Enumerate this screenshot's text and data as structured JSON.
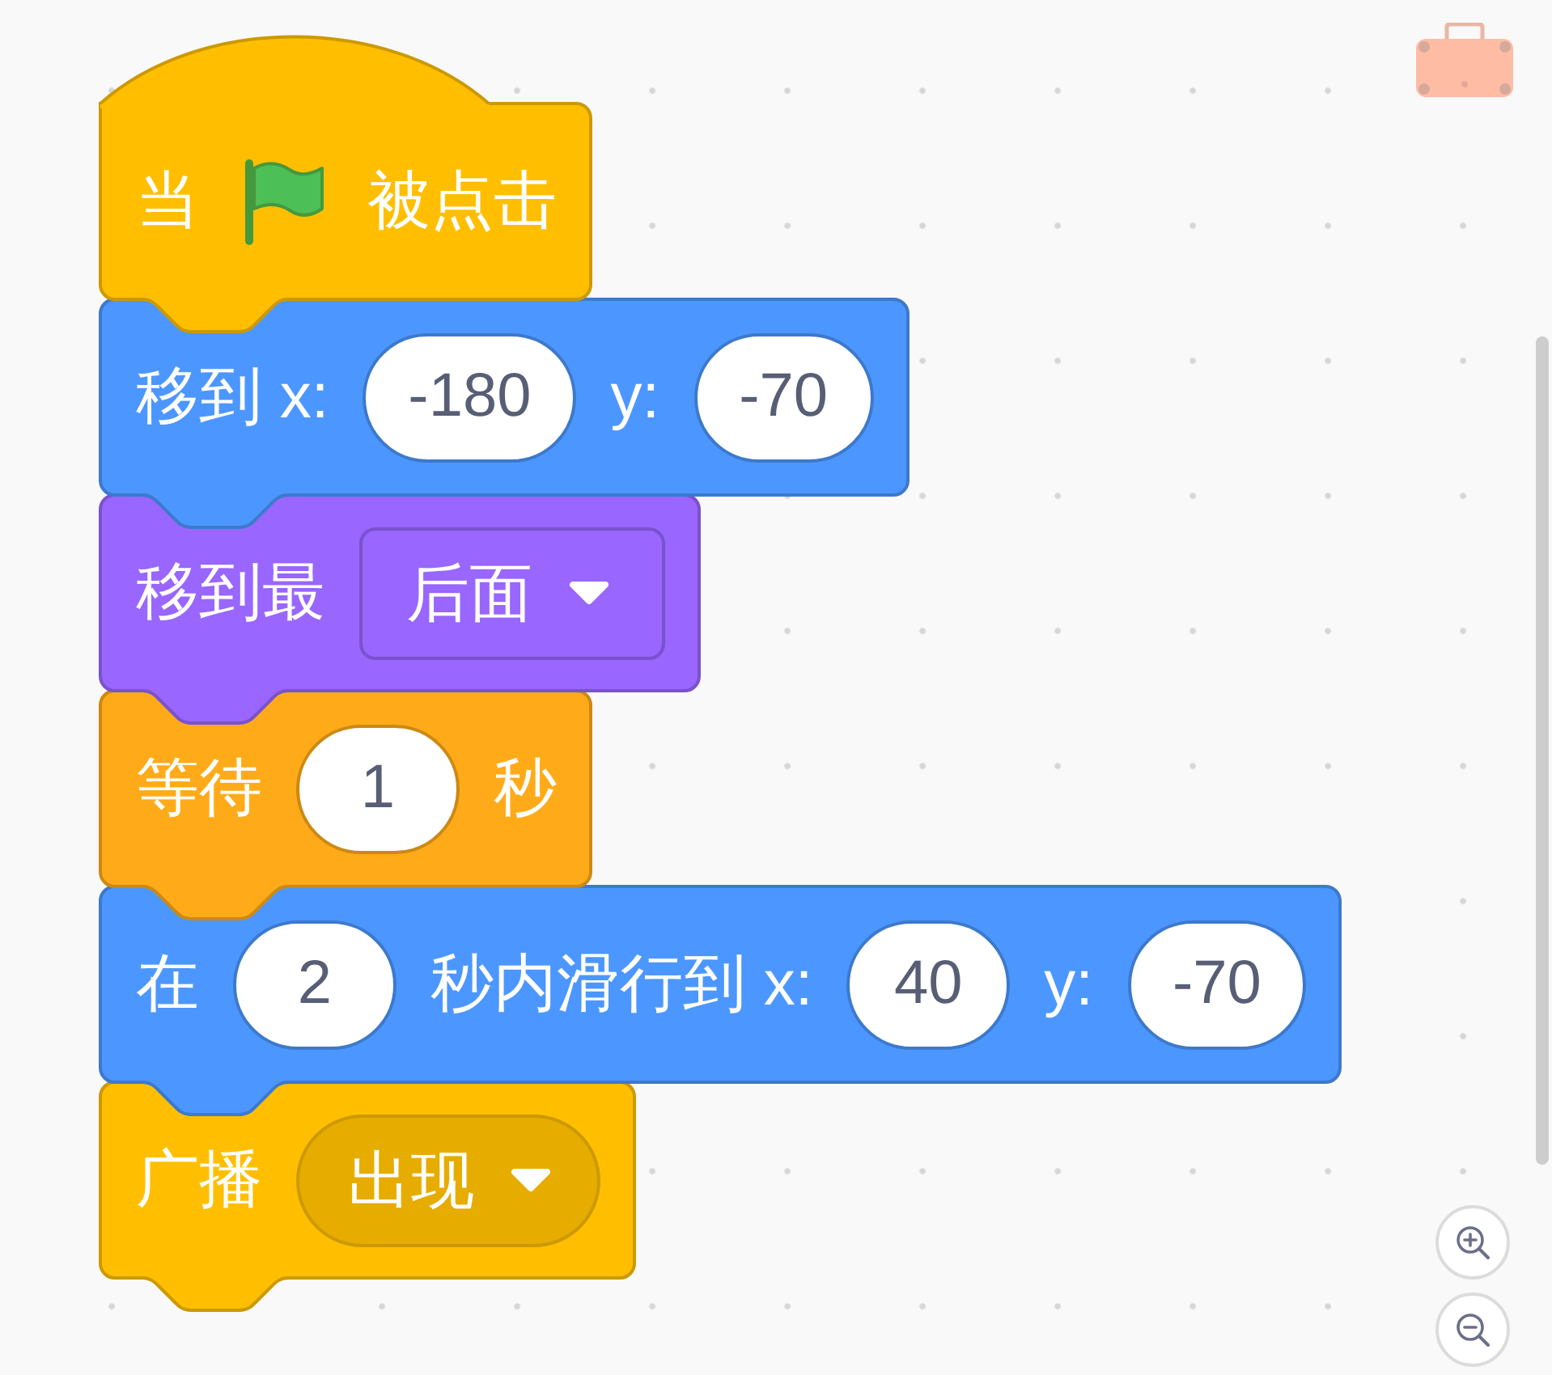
{
  "workspace": {
    "blocks": [
      {
        "kind": "hat",
        "color": "#ffbf00",
        "parts": [
          {
            "kind": "text",
            "text": "当"
          },
          {
            "kind": "icon"
          },
          {
            "kind": "text",
            "text": "被点击"
          }
        ]
      },
      {
        "kind": "stack",
        "color": "#4c97ff",
        "parts": [
          {
            "kind": "text",
            "text": "移到 x:"
          },
          {
            "kind": "number",
            "value": "-180"
          },
          {
            "kind": "text",
            "text": "y:"
          },
          {
            "kind": "number",
            "value": "-70"
          }
        ]
      },
      {
        "kind": "stack",
        "color": "#9966ff",
        "parts": [
          {
            "kind": "text",
            "text": "移到最"
          },
          {
            "kind": "dropdown",
            "value": "后面"
          }
        ]
      },
      {
        "kind": "stack",
        "color": "#ffab19",
        "parts": [
          {
            "kind": "text",
            "text": "等待"
          },
          {
            "kind": "number",
            "value": "1"
          },
          {
            "kind": "text",
            "text": "秒"
          }
        ]
      },
      {
        "kind": "stack",
        "color": "#4c97ff",
        "parts": [
          {
            "kind": "text",
            "text": "在"
          },
          {
            "kind": "number",
            "value": "2"
          },
          {
            "kind": "text",
            "text": "秒内滑行到 x:"
          },
          {
            "kind": "number",
            "value": "40"
          },
          {
            "kind": "text",
            "text": "y:"
          },
          {
            "kind": "number",
            "value": "-70"
          }
        ]
      },
      {
        "kind": "stack",
        "color": "#ffbf00",
        "parts": [
          {
            "kind": "text",
            "text": "广播"
          },
          {
            "kind": "menu",
            "value": "出现"
          }
        ]
      }
    ]
  }
}
